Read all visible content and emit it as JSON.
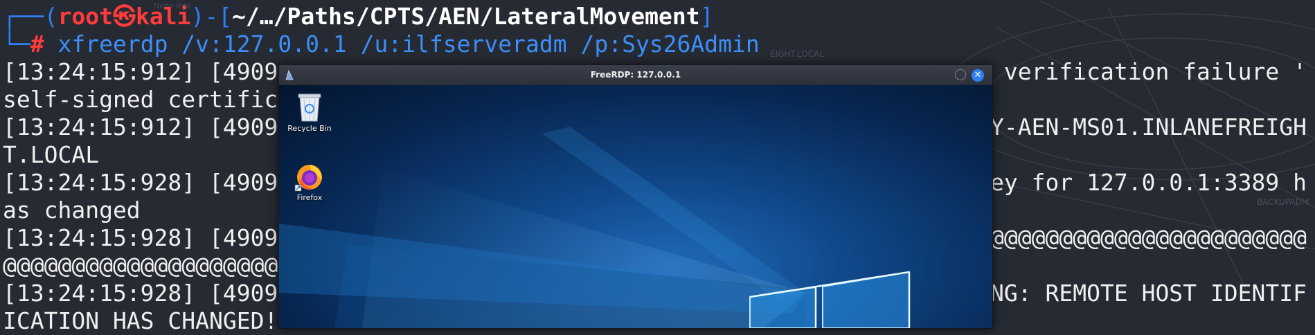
{
  "terminal": {
    "prompt": {
      "user": "root",
      "skull": "㉿",
      "host": "kali",
      "path": "~/…/Paths/CPTS/AEN/LateralMovement",
      "hash": "#"
    },
    "command": "xfreerdp /v:127.0.0.1 /u:ilfserveradm /p:Sys26Admin",
    "lines": [
      {
        "left": "[13:24:15:912] [4909",
        "right": "verification failure '"
      },
      {
        "left": "self-signed certific",
        "right": ""
      },
      {
        "left": "[13:24:15:912] [4909",
        "right": "Y-AEN-MS01.INLANEFREIGH"
      },
      {
        "left": "T.LOCAL",
        "right": ""
      },
      {
        "left": "[13:24:15:928] [4909",
        "right": "ey for 127.0.0.1:3389 h"
      },
      {
        "left": "as changed",
        "right": ""
      },
      {
        "left": "[13:24:15:928] [4909",
        "right": "@@@@@@@@@@@@@@@@@@@@@@@@@"
      },
      {
        "left": "@@@@@@@@@@@@@@@@@@@@@@",
        "right": ""
      },
      {
        "left": "[13:24:15:928] [4909",
        "right": "NG: REMOTE HOST IDENTIF"
      },
      {
        "left": "ICATION HAS CHANGED!",
        "right": ""
      }
    ]
  },
  "rdp_window": {
    "title": "FreeRDP: 127.0.0.1",
    "close_glyph": "✕",
    "desktop_icons": [
      {
        "label": "Recycle Bin",
        "icon": "recycle-bin-icon"
      },
      {
        "label": "Firefox",
        "icon": "firefox-icon"
      }
    ]
  },
  "background_labels": {
    "node_info": "Node Info",
    "freight_local": "EIGHT.LOCAL",
    "backupadm": "BACKUPADM"
  },
  "colors": {
    "prompt_blue": "#2f7ff6",
    "root_red": "#ff3b3b",
    "terminal_bg": "#262a33"
  }
}
